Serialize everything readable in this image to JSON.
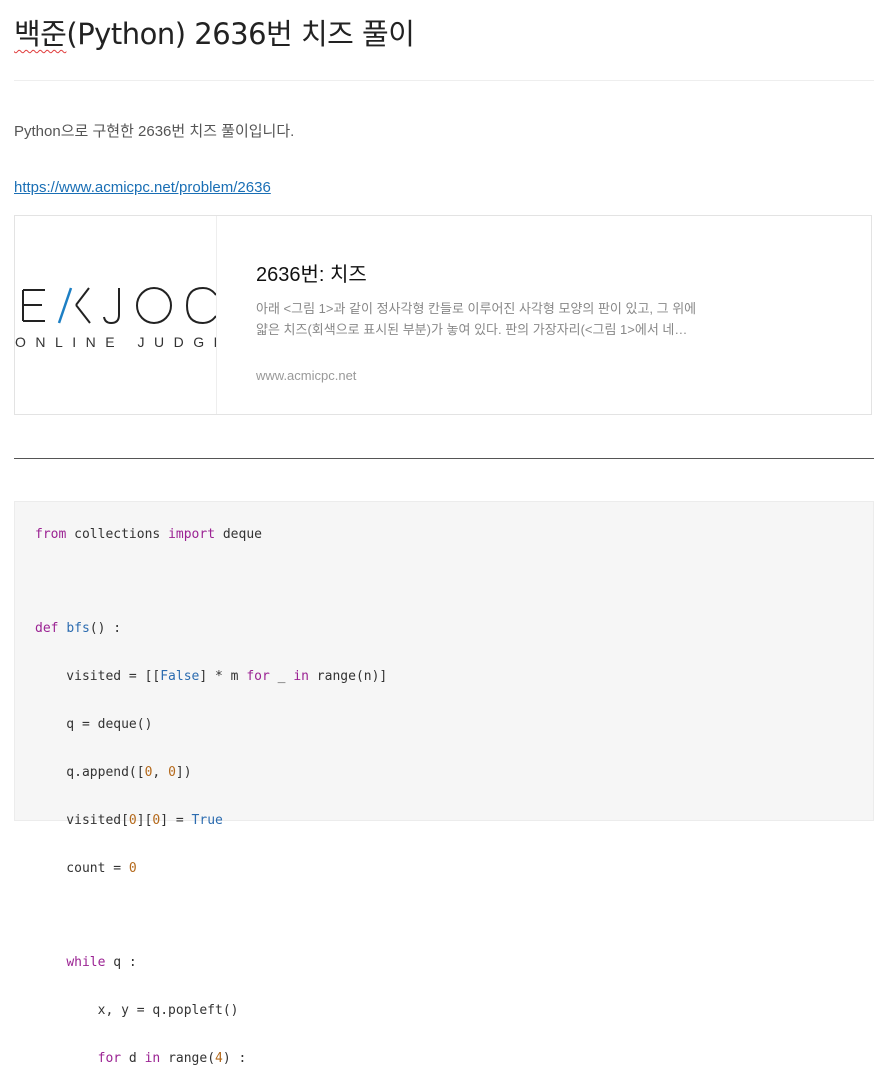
{
  "post": {
    "title_prefix": "백준",
    "title_rest": "(Python) 2636번 치즈 풀이",
    "intro": "Python으로 구현한 2636번 치즈 풀이입니다.",
    "link": "https://www.acmicpc.net/problem/2636"
  },
  "card": {
    "logo_main": "EKJOC",
    "logo_sub": "ONLINE JUDGE",
    "title": "2636번: 치즈",
    "desc_line1": "아래 <그림 1>과 같이 정사각형 칸들로 이루어진 사각형 모양의 판이 있고, 그 위에",
    "desc_line2": "얇은 치즈(회색으로 표시된 부분)가 놓여 있다. 판의 가장자리(<그림 1>에서 네…",
    "domain": "www.acmicpc.net"
  },
  "code": {
    "l1": [
      "from",
      " collections ",
      "import",
      " deque"
    ],
    "l3": [
      "def",
      " ",
      "bfs",
      "() :"
    ],
    "l4": [
      "    visited = [[",
      "False",
      "] * m ",
      "for",
      " _ ",
      "in",
      " ",
      "range",
      "(n)]"
    ],
    "l5": "    q = deque()",
    "l6": [
      "    q.append([",
      "0",
      ", ",
      "0",
      "])"
    ],
    "l7": [
      "    visited[",
      "0",
      "][",
      "0",
      "] = ",
      "True"
    ],
    "l8": [
      "    count = ",
      "0"
    ],
    "l10": [
      "    ",
      "while",
      " q :"
    ],
    "l11": "        x, y = q.popleft()",
    "l12": [
      "        ",
      "for",
      " d ",
      "in",
      " ",
      "range",
      "(",
      "4",
      ") :"
    ]
  },
  "colors": {
    "keyword": "#9b2393",
    "builtin": "#2c6cb0",
    "number": "#b4691b",
    "link": "#1a6fb5",
    "logo_accent": "#1d7fc4"
  }
}
